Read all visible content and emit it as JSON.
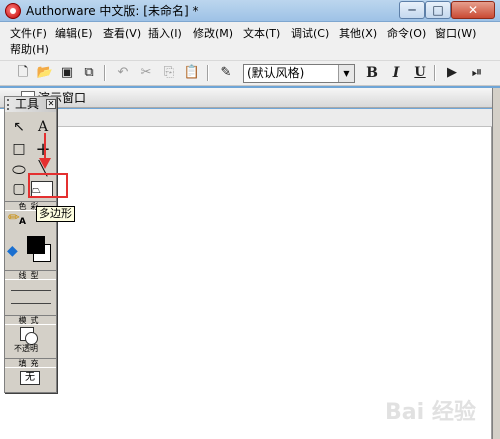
{
  "window": {
    "title": "Authorware 中文版: [未命名] *",
    "minimize": "─",
    "maximize": "□",
    "close": "✕"
  },
  "menu": {
    "row1": [
      "文件(F)",
      "编辑(E)",
      "查看(V)",
      "插入(I)",
      "修改(M)",
      "文本(T)",
      "调试(C)",
      "其他(X)",
      "命令(O)",
      "窗口(W)"
    ],
    "row2": [
      "帮助(H)"
    ]
  },
  "toolbar": {
    "style_select": "(默认风格)",
    "bold": "B",
    "italic": "I",
    "underline": "U"
  },
  "document": {
    "title": "演示窗口"
  },
  "tools": {
    "title": "工具",
    "select_icon": "↖",
    "text_tool": "A",
    "cross_tool": "+",
    "section_color": "色彩",
    "section_line": "线型",
    "section_mode": "模式",
    "mode_value": "不透明",
    "section_fill": "填充",
    "fill_value": "无"
  },
  "tooltip": "多边形",
  "annotation": {
    "highlight_color": "#e43030"
  },
  "watermark": "Bai 经验"
}
